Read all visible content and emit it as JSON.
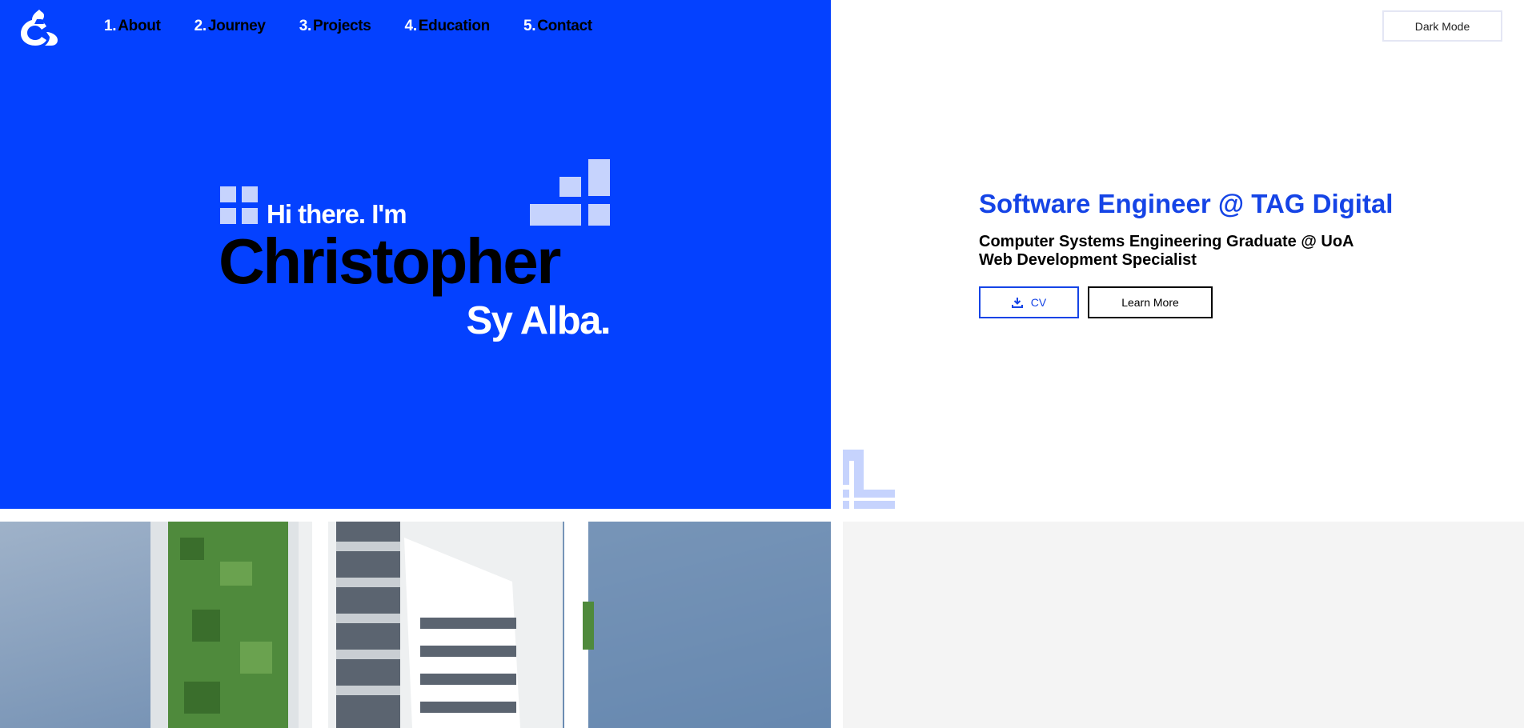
{
  "header": {
    "logo_icon": "ca-monogram-logo-icon",
    "nav": [
      {
        "num": "1.",
        "label": "About"
      },
      {
        "num": "2.",
        "label": "Journey"
      },
      {
        "num": "3.",
        "label": "Projects"
      },
      {
        "num": "4.",
        "label": "Education"
      },
      {
        "num": "5.",
        "label": "Contact"
      }
    ],
    "dark_mode_label": "Dark Mode"
  },
  "hero": {
    "greeting": "Hi there. I'm",
    "first_name": "Christopher",
    "last_name": "Sy Alba."
  },
  "profile": {
    "role": "Software Engineer @ TAG Digital",
    "subtitle_line1": "Computer Systems Engineering Graduate @ UoA",
    "subtitle_line2": "Web Development Specialist",
    "cv_label": "CV",
    "cv_icon": "download-icon",
    "learn_more_label": "Learn More"
  },
  "colors": {
    "accent_blue": "#0441ff",
    "text_blue": "#1544e6",
    "light_square": "#c6d3fd",
    "panel_grey": "#f4f4f4"
  }
}
